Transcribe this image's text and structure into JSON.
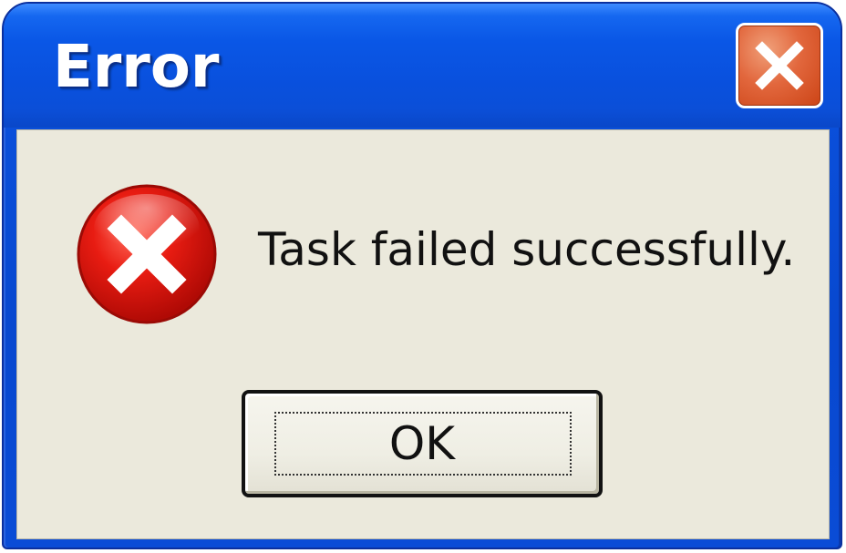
{
  "dialog": {
    "title": "Error",
    "message": "Task failed successfully.",
    "ok_label": "OK",
    "close_icon": "close-icon",
    "status_icon": "error-icon"
  },
  "colors": {
    "titlebar": "#0a57e6",
    "client": "#ebe9dc",
    "close_button": "#e2673d",
    "error_icon": "#e01010"
  }
}
